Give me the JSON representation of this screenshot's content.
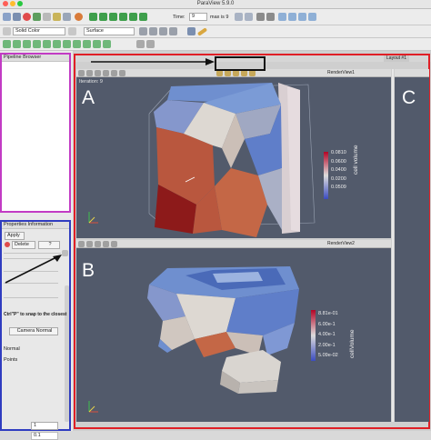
{
  "window": {
    "title": "ParaView 5.9.0"
  },
  "toolbar": {
    "time_label": "Time:",
    "time_value": "9",
    "time_max": "max is 9",
    "coloring": "Solid Color",
    "representation": "Surface"
  },
  "pipeline": {
    "title": "Pipeline Browser"
  },
  "properties": {
    "title": "Properties Information",
    "apply_label": "Apply",
    "delete_label": "Delete",
    "help_label": "?",
    "snap_text": "Ctrl\"P\" to snap to the closest",
    "camera_normal": "Camera Normal",
    "normal_label": "Normal",
    "points_label": "Points",
    "val_1": "1",
    "val_2": "0.1"
  },
  "layout": {
    "tab_label": "Layout #1"
  },
  "view_top": {
    "panel_letter": "A",
    "render_label": "RenderView1",
    "iteration_text": "Iteration: 9",
    "colorbar": {
      "title": "cell volume",
      "ticks": [
        "0.0810",
        "0.0600",
        "0.0400",
        "0.0200",
        "0.0509"
      ]
    }
  },
  "view_bottom": {
    "panel_letter": "B",
    "render_label": "RenderView2",
    "colorbar": {
      "title": "cellVolume",
      "ticks": [
        "8.81e-01",
        "6.00e-1",
        "4.00e-1",
        "2.00e-1",
        "5.09e-02"
      ]
    }
  },
  "view_right": {
    "panel_letter": "C"
  },
  "colors": {
    "view_bg": "#525a6b",
    "highlight_red": "#e01f26",
    "pipeline_magenta": "#c23bc4",
    "properties_blue": "#2f3cc0",
    "cell_red": "#b9573e",
    "cell_blue": "#6f8fcf",
    "cell_white": "#ddd8d2"
  }
}
